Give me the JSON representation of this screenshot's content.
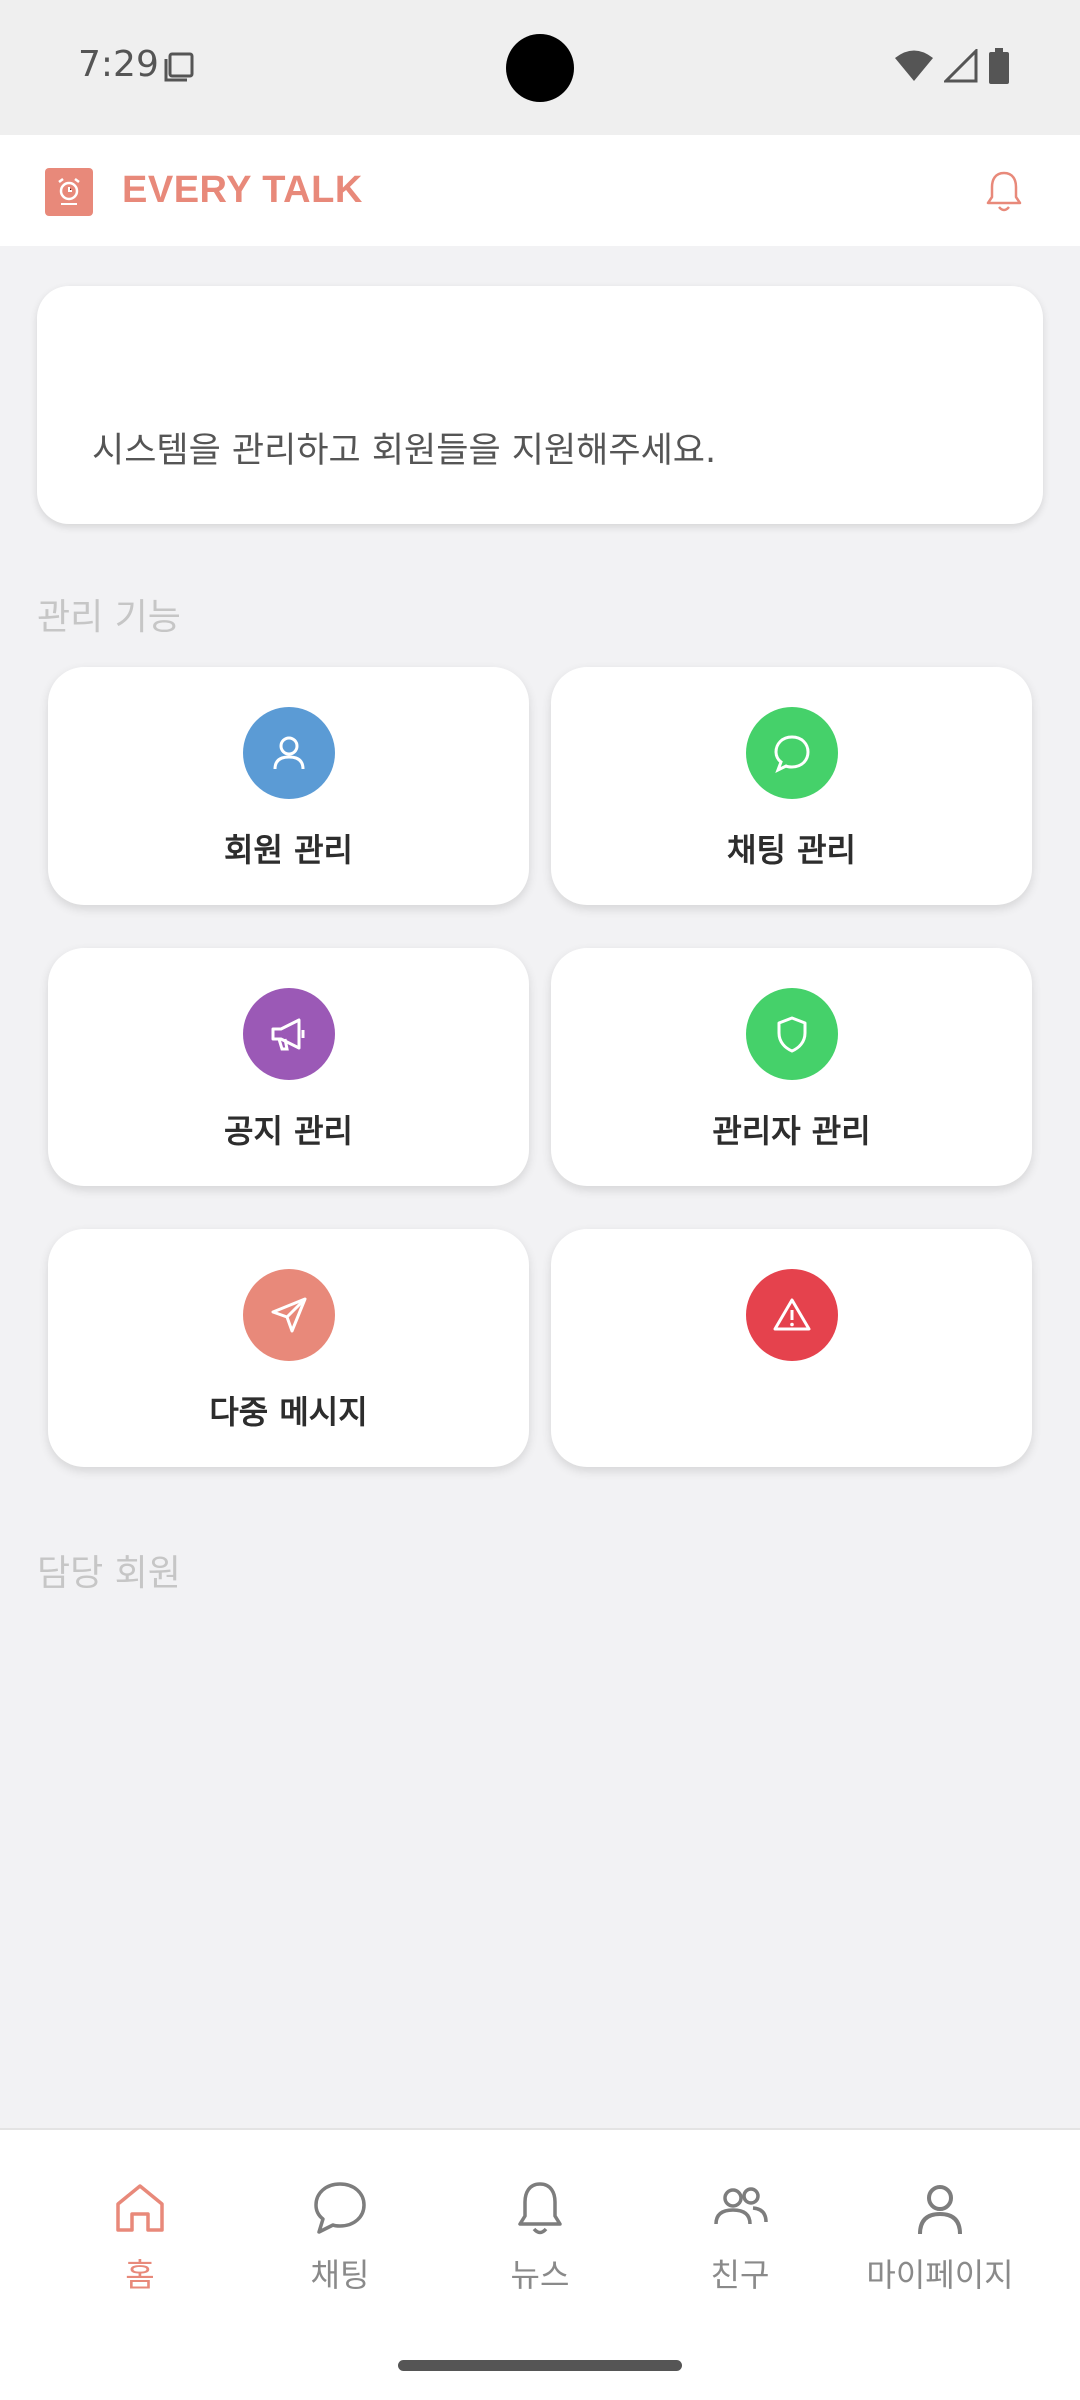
{
  "status_bar": {
    "time": "7:29"
  },
  "app": {
    "title": "EVERY TALK"
  },
  "welcome": {
    "message": "시스템을 관리하고 회원들을 지원해주세요."
  },
  "sections": {
    "management_title": "관리 기능",
    "assigned_title": "담당 회원"
  },
  "tiles": [
    {
      "label": "회원 관리",
      "icon": "user-icon",
      "color": "#5b9bd5"
    },
    {
      "label": "채팅 관리",
      "icon": "chat-bubble-icon",
      "color": "#45d16a"
    },
    {
      "label": "공지 관리",
      "icon": "megaphone-icon",
      "color": "#9b59b6"
    },
    {
      "label": "관리자 관리",
      "icon": "shield-icon",
      "color": "#45d16a"
    },
    {
      "label": "다중 메시지",
      "icon": "send-icon",
      "color": "#e8897a"
    },
    {
      "label": "",
      "icon": "warning-icon",
      "color": "#e5424d"
    }
  ],
  "bottom_nav": [
    {
      "label": "홈",
      "icon": "home-icon",
      "active": true
    },
    {
      "label": "채팅",
      "icon": "chat-icon",
      "active": false
    },
    {
      "label": "뉴스",
      "icon": "bell-icon",
      "active": false
    },
    {
      "label": "친구",
      "icon": "friends-icon",
      "active": false
    },
    {
      "label": "마이페이지",
      "icon": "person-icon",
      "active": false
    }
  ],
  "colors": {
    "accent": "#e8897a",
    "background": "#f2f2f4"
  }
}
